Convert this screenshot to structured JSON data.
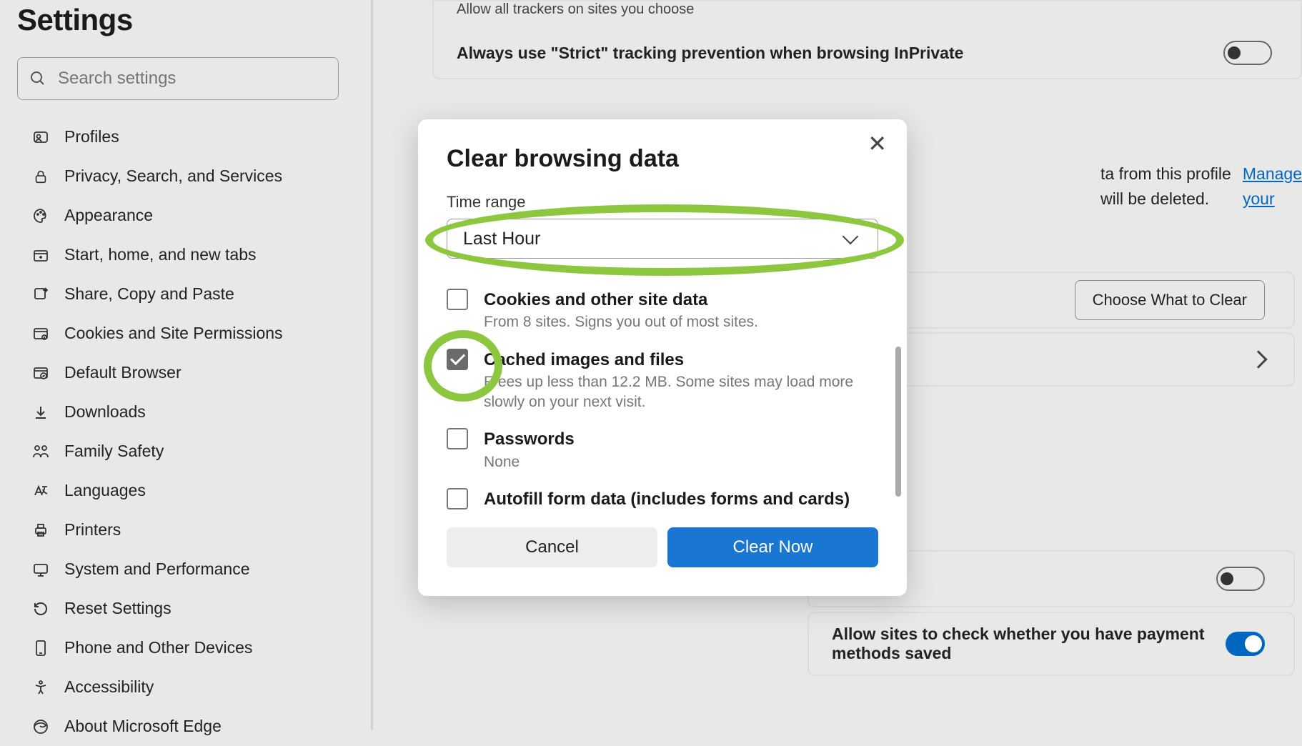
{
  "page_title": "Settings",
  "search": {
    "placeholder": "Search settings"
  },
  "sidebar": {
    "items": [
      {
        "label": "Profiles",
        "icon": "profile-icon"
      },
      {
        "label": "Privacy, Search, and Services",
        "icon": "lock-icon"
      },
      {
        "label": "Appearance",
        "icon": "palette-icon"
      },
      {
        "label": "Start, home, and new tabs",
        "icon": "new-tab-icon"
      },
      {
        "label": "Share, Copy and Paste",
        "icon": "share-icon"
      },
      {
        "label": "Cookies and Site Permissions",
        "icon": "permissions-icon"
      },
      {
        "label": "Default Browser",
        "icon": "browser-icon"
      },
      {
        "label": "Downloads",
        "icon": "download-icon"
      },
      {
        "label": "Family Safety",
        "icon": "family-icon"
      },
      {
        "label": "Languages",
        "icon": "language-icon"
      },
      {
        "label": "Printers",
        "icon": "printer-icon"
      },
      {
        "label": "System and Performance",
        "icon": "system-icon"
      },
      {
        "label": "Reset Settings",
        "icon": "reset-icon"
      },
      {
        "label": "Phone and Other Devices",
        "icon": "phone-icon"
      },
      {
        "label": "Accessibility",
        "icon": "accessibility-icon"
      },
      {
        "label": "About Microsoft Edge",
        "icon": "edge-icon"
      }
    ]
  },
  "main": {
    "trackers_sub": "Allow all trackers on sites you choose",
    "strict_label": "Always use \"Strict\" tracking prevention when browsing InPrivate",
    "partial_text_1": "ta from this profile will be deleted. ",
    "manage_link": "Manage your",
    "choose_btn": "Choose What to Clear",
    "payment_label": "Allow sites to check whether you have payment methods saved"
  },
  "modal": {
    "title": "Clear browsing data",
    "time_label": "Time range",
    "time_value": "Last Hour",
    "items": [
      {
        "title": "Cookies and other site data",
        "desc": "From 8 sites. Signs you out of most sites.",
        "checked": false
      },
      {
        "title": "Cached images and files",
        "desc": "Frees up less than 12.2 MB. Some sites may load more slowly on your next visit.",
        "checked": true
      },
      {
        "title": "Passwords",
        "desc": "None",
        "checked": false
      },
      {
        "title": "Autofill form data (includes forms and cards)",
        "desc": "",
        "checked": false
      }
    ],
    "cancel": "Cancel",
    "clear": "Clear Now"
  }
}
